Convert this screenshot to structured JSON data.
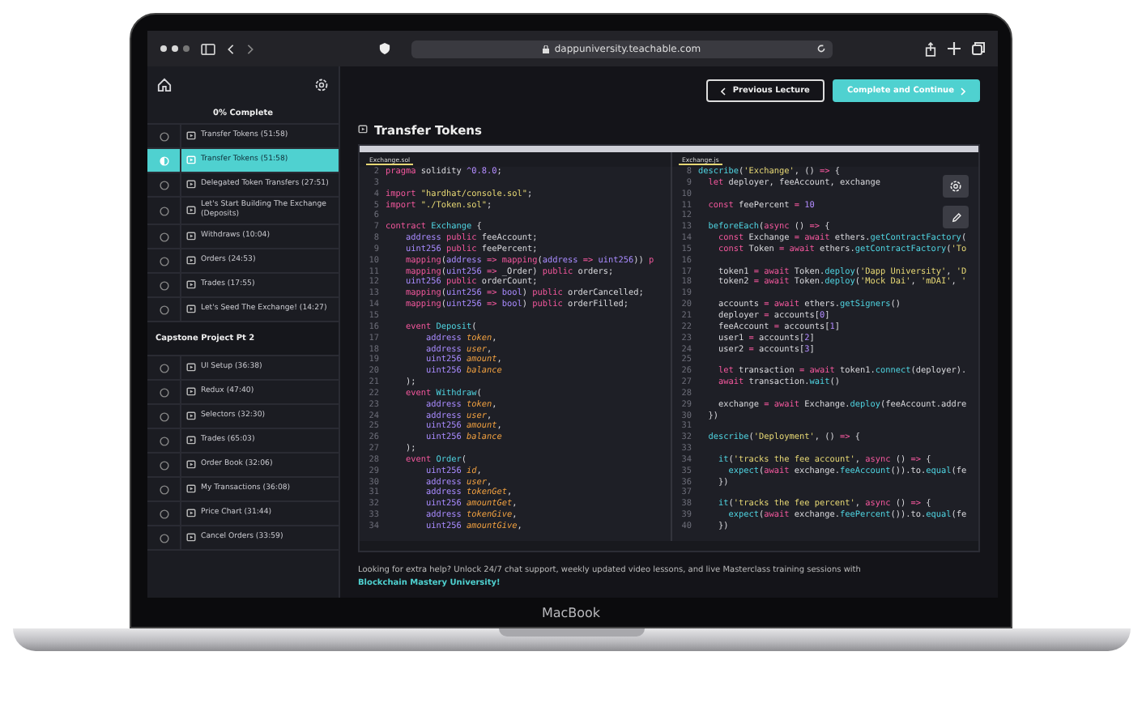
{
  "browser": {
    "url": "dappuniversity.teachable.com"
  },
  "sidebar": {
    "progress": "0% Complete",
    "groups": [
      {
        "lectures": [
          {
            "title": "Transfer Tokens (51:58)",
            "selected": false,
            "in_progress": false
          },
          {
            "title": "Transfer Tokens (51:58)",
            "selected": true,
            "in_progress": true
          },
          {
            "title": "Delegated Token Transfers (27:51)",
            "selected": false,
            "in_progress": false
          },
          {
            "title": "Let's Start Building The Exchange (Deposits)",
            "selected": false,
            "in_progress": false
          },
          {
            "title": "Withdraws (10:04)",
            "selected": false,
            "in_progress": false
          },
          {
            "title": "Orders (24:53)",
            "selected": false,
            "in_progress": false
          },
          {
            "title": "Trades (17:55)",
            "selected": false,
            "in_progress": false
          },
          {
            "title": "Let's Seed The Exchange! (14:27)",
            "selected": false,
            "in_progress": false
          }
        ]
      },
      {
        "title": "Capstone Project Pt 2",
        "lectures": [
          {
            "title": "UI Setup (36:38)",
            "selected": false,
            "in_progress": false
          },
          {
            "title": "Redux (47:40)",
            "selected": false,
            "in_progress": false
          },
          {
            "title": "Selectors (32:30)",
            "selected": false,
            "in_progress": false
          },
          {
            "title": "Trades (65:03)",
            "selected": false,
            "in_progress": false
          },
          {
            "title": "Order Book (32:06)",
            "selected": false,
            "in_progress": false
          },
          {
            "title": "My Transactions (36:08)",
            "selected": false,
            "in_progress": false
          },
          {
            "title": "Price Chart (31:44)",
            "selected": false,
            "in_progress": false
          },
          {
            "title": "Cancel Orders (33:59)",
            "selected": false,
            "in_progress": false
          }
        ]
      }
    ]
  },
  "header": {
    "buttons": [
      {
        "label": "Previous Lecture",
        "kind": "secondary"
      },
      {
        "label": "Complete and Continue",
        "kind": "primary"
      }
    ]
  },
  "lecture": {
    "title": "Transfer Tokens"
  },
  "editor": {
    "panes": [
      {
        "tab": "Exchange.sol",
        "lines": [
          {
            "n": "2",
            "segs": [
              {
                "kind": "kw",
                "text": "pragma "
              },
              {
                "kind": "txt",
                "text": "solidity "
              },
              {
                "kind": "num",
                "text": "^0.8.0"
              },
              {
                "kind": "txt",
                "text": ";"
              }
            ]
          },
          {
            "n": "3"
          },
          {
            "n": "4",
            "segs": [
              {
                "kind": "kw",
                "text": "import "
              },
              {
                "kind": "str",
                "text": "\"hardhat/console.sol\""
              },
              {
                "kind": "txt",
                "text": ";"
              }
            ]
          },
          {
            "n": "5",
            "segs": [
              {
                "kind": "kw",
                "text": "import "
              },
              {
                "kind": "str",
                "text": "\"./Token.sol\""
              },
              {
                "kind": "txt",
                "text": ";"
              }
            ]
          },
          {
            "n": "6"
          },
          {
            "n": "7",
            "segs": [
              {
                "kind": "kw",
                "text": "contract "
              },
              {
                "kind": "fn",
                "text": "Exchange"
              },
              {
                "kind": "txt",
                "text": " {"
              }
            ]
          },
          {
            "n": "8",
            "segs": [
              {
                "kind": "type",
                "text": "    address "
              },
              {
                "kind": "kw",
                "text": "public "
              },
              {
                "kind": "txt",
                "text": "feeAccount;"
              }
            ]
          },
          {
            "n": "9",
            "segs": [
              {
                "kind": "type",
                "text": "    uint256 "
              },
              {
                "kind": "kw",
                "text": "public "
              },
              {
                "kind": "txt",
                "text": "feePercent;"
              }
            ]
          },
          {
            "n": "10",
            "segs": [
              {
                "kind": "kw",
                "text": "    mapping"
              },
              {
                "kind": "txt",
                "text": "("
              },
              {
                "kind": "type",
                "text": "address"
              },
              {
                "kind": "kw",
                "text": " => "
              },
              {
                "kind": "kw",
                "text": "mapping"
              },
              {
                "kind": "txt",
                "text": "("
              },
              {
                "kind": "type",
                "text": "address"
              },
              {
                "kind": "kw",
                "text": " => "
              },
              {
                "kind": "type",
                "text": "uint256"
              },
              {
                "kind": "txt",
                "text": ")) "
              },
              {
                "kind": "kw",
                "text": "p"
              }
            ]
          },
          {
            "n": "11",
            "segs": [
              {
                "kind": "kw",
                "text": "    mapping"
              },
              {
                "kind": "txt",
                "text": "("
              },
              {
                "kind": "type",
                "text": "uint256"
              },
              {
                "kind": "kw",
                "text": " => "
              },
              {
                "kind": "txt",
                "text": "_Order) "
              },
              {
                "kind": "kw",
                "text": "public "
              },
              {
                "kind": "txt",
                "text": "orders;"
              }
            ]
          },
          {
            "n": "12",
            "segs": [
              {
                "kind": "type",
                "text": "    uint256 "
              },
              {
                "kind": "kw",
                "text": "public "
              },
              {
                "kind": "txt",
                "text": "orderCount;"
              }
            ]
          },
          {
            "n": "13",
            "segs": [
              {
                "kind": "kw",
                "text": "    mapping"
              },
              {
                "kind": "txt",
                "text": "("
              },
              {
                "kind": "type",
                "text": "uint256"
              },
              {
                "kind": "kw",
                "text": " => "
              },
              {
                "kind": "type",
                "text": "bool"
              },
              {
                "kind": "txt",
                "text": ") "
              },
              {
                "kind": "kw",
                "text": "public "
              },
              {
                "kind": "txt",
                "text": "orderCancelled;"
              }
            ]
          },
          {
            "n": "14",
            "segs": [
              {
                "kind": "kw",
                "text": "    mapping"
              },
              {
                "kind": "txt",
                "text": "("
              },
              {
                "kind": "type",
                "text": "uint256"
              },
              {
                "kind": "kw",
                "text": " => "
              },
              {
                "kind": "type",
                "text": "bool"
              },
              {
                "kind": "txt",
                "text": ") "
              },
              {
                "kind": "kw",
                "text": "public "
              },
              {
                "kind": "txt",
                "text": "orderFilled;"
              }
            ]
          },
          {
            "n": "15"
          },
          {
            "n": "16",
            "segs": [
              {
                "kind": "kw",
                "text": "    event "
              },
              {
                "kind": "fn",
                "text": "Deposit"
              },
              {
                "kind": "txt",
                "text": "("
              }
            ]
          },
          {
            "n": "17",
            "segs": [
              {
                "kind": "type",
                "text": "        address "
              },
              {
                "kind": "var",
                "text": "token"
              },
              {
                "kind": "txt",
                "text": ","
              }
            ]
          },
          {
            "n": "18",
            "segs": [
              {
                "kind": "type",
                "text": "        address "
              },
              {
                "kind": "var",
                "text": "user"
              },
              {
                "kind": "txt",
                "text": ","
              }
            ]
          },
          {
            "n": "19",
            "segs": [
              {
                "kind": "type",
                "text": "        uint256 "
              },
              {
                "kind": "var",
                "text": "amount"
              },
              {
                "kind": "txt",
                "text": ","
              }
            ]
          },
          {
            "n": "20",
            "segs": [
              {
                "kind": "type",
                "text": "        uint256 "
              },
              {
                "kind": "var",
                "text": "balance"
              }
            ]
          },
          {
            "n": "21",
            "segs": [
              {
                "kind": "txt",
                "text": "    );"
              }
            ]
          },
          {
            "n": "22",
            "segs": [
              {
                "kind": "kw",
                "text": "    event "
              },
              {
                "kind": "fn",
                "text": "Withdraw"
              },
              {
                "kind": "txt",
                "text": "("
              }
            ]
          },
          {
            "n": "23",
            "segs": [
              {
                "kind": "type",
                "text": "        address "
              },
              {
                "kind": "var",
                "text": "token"
              },
              {
                "kind": "txt",
                "text": ","
              }
            ]
          },
          {
            "n": "24",
            "segs": [
              {
                "kind": "type",
                "text": "        address "
              },
              {
                "kind": "var",
                "text": "user"
              },
              {
                "kind": "txt",
                "text": ","
              }
            ]
          },
          {
            "n": "25",
            "segs": [
              {
                "kind": "type",
                "text": "        uint256 "
              },
              {
                "kind": "var",
                "text": "amount"
              },
              {
                "kind": "txt",
                "text": ","
              }
            ]
          },
          {
            "n": "26",
            "segs": [
              {
                "kind": "type",
                "text": "        uint256 "
              },
              {
                "kind": "var",
                "text": "balance"
              }
            ]
          },
          {
            "n": "27",
            "segs": [
              {
                "kind": "txt",
                "text": "    );"
              }
            ]
          },
          {
            "n": "28",
            "segs": [
              {
                "kind": "kw",
                "text": "    event "
              },
              {
                "kind": "fn",
                "text": "Order"
              },
              {
                "kind": "txt",
                "text": "("
              }
            ]
          },
          {
            "n": "29",
            "segs": [
              {
                "kind": "type",
                "text": "        uint256 "
              },
              {
                "kind": "var",
                "text": "id"
              },
              {
                "kind": "txt",
                "text": ","
              }
            ]
          },
          {
            "n": "30",
            "segs": [
              {
                "kind": "type",
                "text": "        address "
              },
              {
                "kind": "var",
                "text": "user"
              },
              {
                "kind": "txt",
                "text": ","
              }
            ]
          },
          {
            "n": "31",
            "segs": [
              {
                "kind": "type",
                "text": "        address "
              },
              {
                "kind": "var",
                "text": "tokenGet"
              },
              {
                "kind": "txt",
                "text": ","
              }
            ]
          },
          {
            "n": "32",
            "segs": [
              {
                "kind": "type",
                "text": "        uint256 "
              },
              {
                "kind": "var",
                "text": "amountGet"
              },
              {
                "kind": "txt",
                "text": ","
              }
            ]
          },
          {
            "n": "33",
            "segs": [
              {
                "kind": "type",
                "text": "        address "
              },
              {
                "kind": "var",
                "text": "tokenGive"
              },
              {
                "kind": "txt",
                "text": ","
              }
            ]
          },
          {
            "n": "34",
            "segs": [
              {
                "kind": "type",
                "text": "        uint256 "
              },
              {
                "kind": "var",
                "text": "amountGive"
              },
              {
                "kind": "txt",
                "text": ","
              }
            ]
          }
        ]
      },
      {
        "tab": "Exchange.js",
        "lines": [
          {
            "n": "8",
            "segs": [
              {
                "kind": "fn",
                "text": "describe"
              },
              {
                "kind": "txt",
                "text": "("
              },
              {
                "kind": "str",
                "text": "'Exchange'"
              },
              {
                "kind": "txt",
                "text": ", () "
              },
              {
                "kind": "kw",
                "text": "=>"
              },
              {
                "kind": "txt",
                "text": " {"
              }
            ]
          },
          {
            "n": "9",
            "segs": [
              {
                "kind": "kw",
                "text": "  let "
              },
              {
                "kind": "txt",
                "text": "deployer, feeAccount, exchange"
              }
            ]
          },
          {
            "n": "10"
          },
          {
            "n": "11",
            "segs": [
              {
                "kind": "kw",
                "text": "  const "
              },
              {
                "kind": "txt",
                "text": "feePercent "
              },
              {
                "kind": "kw",
                "text": "= "
              },
              {
                "kind": "num",
                "text": "10"
              }
            ]
          },
          {
            "n": "12"
          },
          {
            "n": "13",
            "segs": [
              {
                "kind": "fn",
                "text": "  beforeEach"
              },
              {
                "kind": "txt",
                "text": "("
              },
              {
                "kind": "kw",
                "text": "async"
              },
              {
                "kind": "txt",
                "text": " () "
              },
              {
                "kind": "kw",
                "text": "=>"
              },
              {
                "kind": "txt",
                "text": " {"
              }
            ]
          },
          {
            "n": "14",
            "segs": [
              {
                "kind": "kw",
                "text": "    const "
              },
              {
                "kind": "txt",
                "text": "Exchange "
              },
              {
                "kind": "kw",
                "text": "= await "
              },
              {
                "kind": "txt",
                "text": "ethers."
              },
              {
                "kind": "fn",
                "text": "getContractFactory"
              },
              {
                "kind": "txt",
                "text": "("
              }
            ]
          },
          {
            "n": "15",
            "segs": [
              {
                "kind": "kw",
                "text": "    const "
              },
              {
                "kind": "txt",
                "text": "Token "
              },
              {
                "kind": "kw",
                "text": "= await "
              },
              {
                "kind": "txt",
                "text": "ethers."
              },
              {
                "kind": "fn",
                "text": "getContractFactory"
              },
              {
                "kind": "txt",
                "text": "("
              },
              {
                "kind": "str",
                "text": "'To"
              }
            ]
          },
          {
            "n": "16"
          },
          {
            "n": "17",
            "segs": [
              {
                "kind": "txt",
                "text": "    token1 "
              },
              {
                "kind": "kw",
                "text": "= await "
              },
              {
                "kind": "txt",
                "text": "Token."
              },
              {
                "kind": "fn",
                "text": "deploy"
              },
              {
                "kind": "txt",
                "text": "("
              },
              {
                "kind": "str",
                "text": "'Dapp University'"
              },
              {
                "kind": "txt",
                "text": ", "
              },
              {
                "kind": "str",
                "text": "'D"
              }
            ]
          },
          {
            "n": "18",
            "segs": [
              {
                "kind": "txt",
                "text": "    token2 "
              },
              {
                "kind": "kw",
                "text": "= await "
              },
              {
                "kind": "txt",
                "text": "Token."
              },
              {
                "kind": "fn",
                "text": "deploy"
              },
              {
                "kind": "txt",
                "text": "("
              },
              {
                "kind": "str",
                "text": "'Mock Dai'"
              },
              {
                "kind": "txt",
                "text": ", "
              },
              {
                "kind": "str",
                "text": "'mDAI'"
              },
              {
                "kind": "txt",
                "text": ", "
              },
              {
                "kind": "str",
                "text": "'"
              }
            ]
          },
          {
            "n": "19"
          },
          {
            "n": "20",
            "segs": [
              {
                "kind": "txt",
                "text": "    accounts "
              },
              {
                "kind": "kw",
                "text": "= await "
              },
              {
                "kind": "txt",
                "text": "ethers."
              },
              {
                "kind": "fn",
                "text": "getSigners"
              },
              {
                "kind": "txt",
                "text": "()"
              }
            ]
          },
          {
            "n": "21",
            "segs": [
              {
                "kind": "txt",
                "text": "    deployer "
              },
              {
                "kind": "kw",
                "text": "= "
              },
              {
                "kind": "txt",
                "text": "accounts["
              },
              {
                "kind": "num",
                "text": "0"
              },
              {
                "kind": "txt",
                "text": "]"
              }
            ]
          },
          {
            "n": "22",
            "segs": [
              {
                "kind": "txt",
                "text": "    feeAccount "
              },
              {
                "kind": "kw",
                "text": "= "
              },
              {
                "kind": "txt",
                "text": "accounts["
              },
              {
                "kind": "num",
                "text": "1"
              },
              {
                "kind": "txt",
                "text": "]"
              }
            ]
          },
          {
            "n": "23",
            "segs": [
              {
                "kind": "txt",
                "text": "    user1 "
              },
              {
                "kind": "kw",
                "text": "= "
              },
              {
                "kind": "txt",
                "text": "accounts["
              },
              {
                "kind": "num",
                "text": "2"
              },
              {
                "kind": "txt",
                "text": "]"
              }
            ]
          },
          {
            "n": "24",
            "segs": [
              {
                "kind": "txt",
                "text": "    user2 "
              },
              {
                "kind": "kw",
                "text": "= "
              },
              {
                "kind": "txt",
                "text": "accounts["
              },
              {
                "kind": "num",
                "text": "3"
              },
              {
                "kind": "txt",
                "text": "]"
              }
            ]
          },
          {
            "n": "25"
          },
          {
            "n": "26",
            "segs": [
              {
                "kind": "kw",
                "text": "    let "
              },
              {
                "kind": "txt",
                "text": "transaction "
              },
              {
                "kind": "kw",
                "text": "= await "
              },
              {
                "kind": "txt",
                "text": "token1."
              },
              {
                "kind": "fn",
                "text": "connect"
              },
              {
                "kind": "txt",
                "text": "(deployer)."
              }
            ]
          },
          {
            "n": "27",
            "segs": [
              {
                "kind": "kw",
                "text": "    await "
              },
              {
                "kind": "txt",
                "text": "transaction."
              },
              {
                "kind": "fn",
                "text": "wait"
              },
              {
                "kind": "txt",
                "text": "()"
              }
            ]
          },
          {
            "n": "28"
          },
          {
            "n": "29",
            "segs": [
              {
                "kind": "txt",
                "text": "    exchange "
              },
              {
                "kind": "kw",
                "text": "= await "
              },
              {
                "kind": "txt",
                "text": "Exchange."
              },
              {
                "kind": "fn",
                "text": "deploy"
              },
              {
                "kind": "txt",
                "text": "(feeAccount.addre"
              }
            ]
          },
          {
            "n": "30",
            "segs": [
              {
                "kind": "txt",
                "text": "  })"
              }
            ]
          },
          {
            "n": "31"
          },
          {
            "n": "32",
            "segs": [
              {
                "kind": "fn",
                "text": "  describe"
              },
              {
                "kind": "txt",
                "text": "("
              },
              {
                "kind": "str",
                "text": "'Deployment'"
              },
              {
                "kind": "txt",
                "text": ", () "
              },
              {
                "kind": "kw",
                "text": "=>"
              },
              {
                "kind": "txt",
                "text": " {"
              }
            ]
          },
          {
            "n": "33"
          },
          {
            "n": "34",
            "segs": [
              {
                "kind": "fn",
                "text": "    it"
              },
              {
                "kind": "txt",
                "text": "("
              },
              {
                "kind": "str",
                "text": "'tracks the fee account'"
              },
              {
                "kind": "txt",
                "text": ", "
              },
              {
                "kind": "kw",
                "text": "async"
              },
              {
                "kind": "txt",
                "text": " () "
              },
              {
                "kind": "kw",
                "text": "=>"
              },
              {
                "kind": "txt",
                "text": " {"
              }
            ]
          },
          {
            "n": "35",
            "segs": [
              {
                "kind": "fn",
                "text": "      expect"
              },
              {
                "kind": "txt",
                "text": "("
              },
              {
                "kind": "kw",
                "text": "await "
              },
              {
                "kind": "txt",
                "text": "exchange."
              },
              {
                "kind": "fn",
                "text": "feeAccount"
              },
              {
                "kind": "txt",
                "text": "()).to."
              },
              {
                "kind": "fn",
                "text": "equal"
              },
              {
                "kind": "txt",
                "text": "(fe"
              }
            ]
          },
          {
            "n": "36",
            "segs": [
              {
                "kind": "txt",
                "text": "    })"
              }
            ]
          },
          {
            "n": "37"
          },
          {
            "n": "38",
            "segs": [
              {
                "kind": "fn",
                "text": "    it"
              },
              {
                "kind": "txt",
                "text": "("
              },
              {
                "kind": "str",
                "text": "'tracks the fee percent'"
              },
              {
                "kind": "txt",
                "text": ", "
              },
              {
                "kind": "kw",
                "text": "async"
              },
              {
                "kind": "txt",
                "text": " () "
              },
              {
                "kind": "kw",
                "text": "=>"
              },
              {
                "kind": "txt",
                "text": " {"
              }
            ]
          },
          {
            "n": "39",
            "segs": [
              {
                "kind": "fn",
                "text": "      expect"
              },
              {
                "kind": "txt",
                "text": "("
              },
              {
                "kind": "kw",
                "text": "await "
              },
              {
                "kind": "txt",
                "text": "exchange."
              },
              {
                "kind": "fn",
                "text": "feePercent"
              },
              {
                "kind": "txt",
                "text": "()).to."
              },
              {
                "kind": "fn",
                "text": "equal"
              },
              {
                "kind": "txt",
                "text": "(fe"
              }
            ]
          },
          {
            "n": "40",
            "segs": [
              {
                "kind": "txt",
                "text": "    })"
              }
            ]
          }
        ]
      }
    ]
  },
  "footer": {
    "text": "Looking for extra help? Unlock 24/7 chat support, weekly updated video lessons, and live Masterclass training sessions with",
    "link": "Blockchain Mastery University!"
  },
  "device": {
    "label": "MacBook"
  }
}
